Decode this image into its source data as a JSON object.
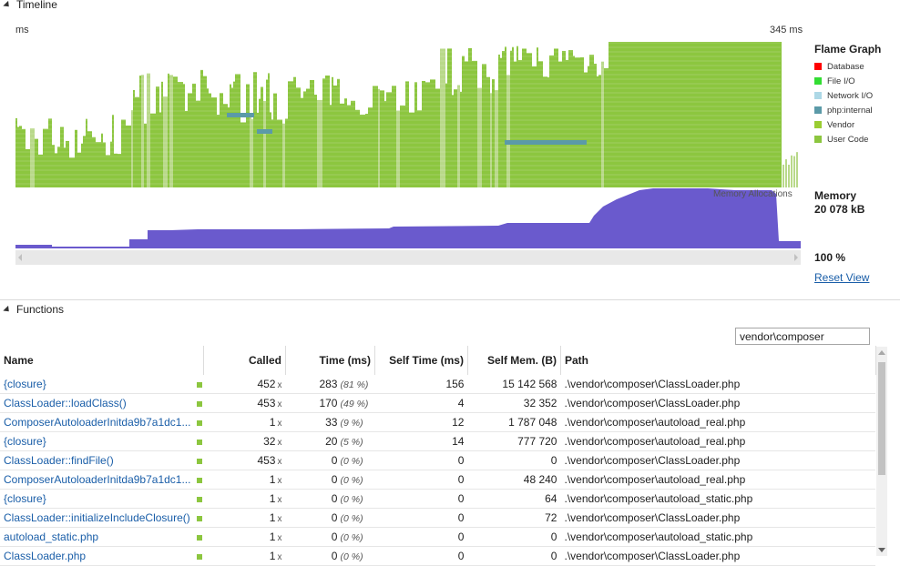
{
  "timeline": {
    "section_title": "Timeline",
    "start_label": "ms",
    "end_label": "345 ms",
    "legend_title": "Flame Graph",
    "legend": [
      {
        "label": "Database",
        "color": "#ff0000"
      },
      {
        "label": "File I/O",
        "color": "#33dd33"
      },
      {
        "label": "Network I/O",
        "color": "#add8e6"
      },
      {
        "label": "php:internal",
        "color": "#5b9aa8"
      },
      {
        "label": "Vendor",
        "color": "#9acd32"
      },
      {
        "label": "User Code",
        "color": "#8cc63f"
      }
    ],
    "memory_overlay_label": "Memory Allocations",
    "memory_title": "Memory",
    "memory_value": "20 078 kB",
    "zoom": "100 %",
    "reset_view": "Reset View"
  },
  "functions": {
    "section_title": "Functions",
    "search_value": "vendor\\composer",
    "columns": [
      "Name",
      "Called",
      "Time (ms)",
      "Self Time (ms)",
      "Self Mem. (B)",
      "Path"
    ],
    "rows": [
      {
        "name": "{closure}",
        "called": "452",
        "time": "283",
        "time_pct": "(81 %)",
        "self_time": "156",
        "self_mem": "15 142 568",
        "path": ".\\vendor\\composer\\ClassLoader.php"
      },
      {
        "name": "ClassLoader::loadClass()",
        "called": "453",
        "time": "170",
        "time_pct": "(49 %)",
        "self_time": "4",
        "self_mem": "32 352",
        "path": ".\\vendor\\composer\\ClassLoader.php"
      },
      {
        "name": "ComposerAutoloaderInitda9b7a1dc1...",
        "called": "1",
        "time": "33",
        "time_pct": "(9 %)",
        "self_time": "12",
        "self_mem": "1 787 048",
        "path": ".\\vendor\\composer\\autoload_real.php"
      },
      {
        "name": "{closure}",
        "called": "32",
        "time": "20",
        "time_pct": "(5 %)",
        "self_time": "14",
        "self_mem": "777 720",
        "path": ".\\vendor\\composer\\autoload_real.php"
      },
      {
        "name": "ClassLoader::findFile()",
        "called": "453",
        "time": "0",
        "time_pct": "(0 %)",
        "self_time": "0",
        "self_mem": "0",
        "path": ".\\vendor\\composer\\ClassLoader.php"
      },
      {
        "name": "ComposerAutoloaderInitda9b7a1dc1...",
        "called": "1",
        "time": "0",
        "time_pct": "(0 %)",
        "self_time": "0",
        "self_mem": "48 240",
        "path": ".\\vendor\\composer\\autoload_real.php"
      },
      {
        "name": "{closure}",
        "called": "1",
        "time": "0",
        "time_pct": "(0 %)",
        "self_time": "0",
        "self_mem": "64",
        "path": ".\\vendor\\composer\\autoload_static.php"
      },
      {
        "name": "ClassLoader::initializeIncludeClosure()",
        "called": "1",
        "time": "0",
        "time_pct": "(0 %)",
        "self_time": "0",
        "self_mem": "72",
        "path": ".\\vendor\\composer\\ClassLoader.php"
      },
      {
        "name": "autoload_static.php",
        "called": "1",
        "time": "0",
        "time_pct": "(0 %)",
        "self_time": "0",
        "self_mem": "0",
        "path": ".\\vendor\\composer\\autoload_static.php"
      },
      {
        "name": "ClassLoader.php",
        "called": "1",
        "time": "0",
        "time_pct": "(0 %)",
        "self_time": "0",
        "self_mem": "0",
        "path": ".\\vendor\\composer\\ClassLoader.php"
      }
    ]
  }
}
